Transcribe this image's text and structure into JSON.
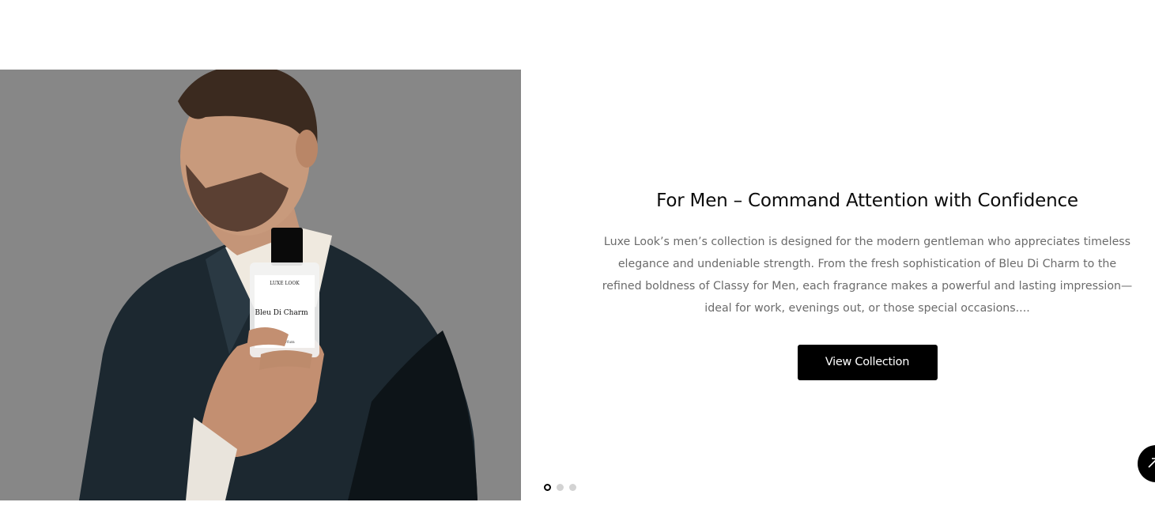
{
  "hero": {
    "title": "For Men – Command Attention with Confidence",
    "description": "Luxe Look’s men’s collection is designed for the modern gentleman who appreciates timeless elegance and undeniable strength. From the fresh sophistication of Bleu Di Charm to the refined boldness of Classy for Men, each fragrance makes a powerful and lasting impression—ideal for work, evenings out, or those special occasions....",
    "cta_label": "View Collection",
    "image": {
      "bottle_brand": "LUXE LOOK",
      "bottle_name": "Bleu Di Charm",
      "bottle_type": "Eau de parfum"
    }
  },
  "carousel": {
    "slide_count": 3,
    "active_index": 0
  },
  "scroll_top": {
    "icon": "arrow-up-icon"
  },
  "colors": {
    "image_background": "#878787",
    "button_background": "#000000",
    "button_text": "#ffffff",
    "title_text": "#0b0b0b",
    "body_text": "#6b6b6b"
  }
}
